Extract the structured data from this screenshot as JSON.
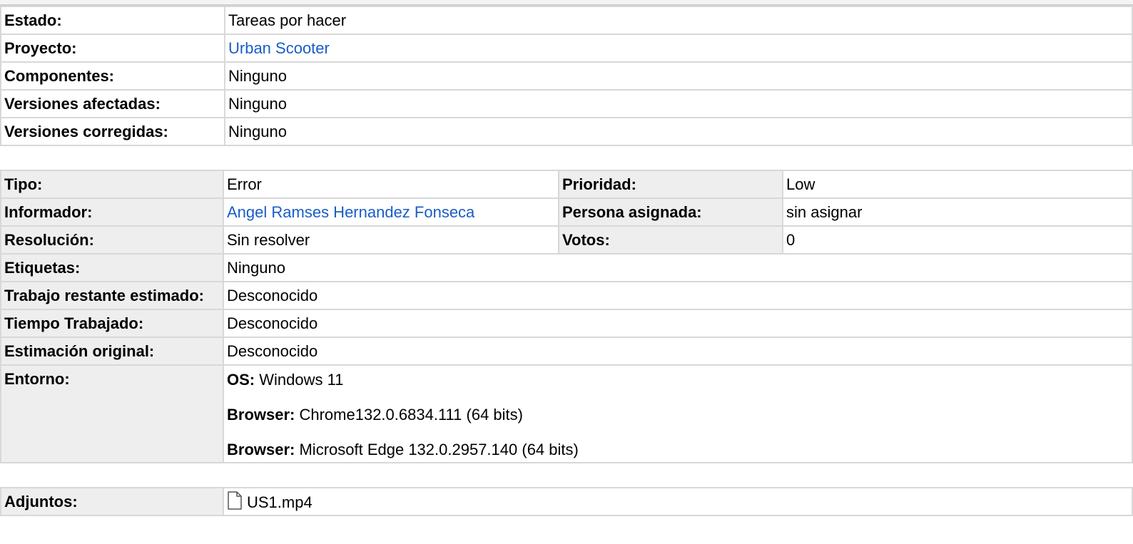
{
  "section1": [
    {
      "label": "Estado:",
      "value": "Tareas por hacer"
    },
    {
      "label": "Proyecto:",
      "value": "Urban Scooter"
    },
    {
      "label": "Componentes:",
      "value": "Ninguno"
    },
    {
      "label": "Versiones afectadas:",
      "value": "Ninguno"
    },
    {
      "label": "Versiones corregidas:",
      "value": "Ninguno"
    }
  ],
  "section2": {
    "tipo": {
      "label": "Tipo:",
      "value": "Error"
    },
    "prioridad": {
      "label": "Prioridad:",
      "value": "Low"
    },
    "informador": {
      "label": "Informador:",
      "value": "Angel Ramses Hernandez Fonseca"
    },
    "asignada": {
      "label": "Persona asignada:",
      "value": "sin asignar"
    },
    "resolucion": {
      "label": "Resolución:",
      "value": "Sin resolver"
    },
    "votos": {
      "label": "Votos:",
      "value": "0"
    },
    "etiquetas": {
      "label": "Etiquetas:",
      "value": "Ninguno"
    },
    "trabajo": {
      "label": "Trabajo restante estimado:",
      "value": "Desconocido"
    },
    "tiempo": {
      "label": "Tiempo Trabajado:",
      "value": "Desconocido"
    },
    "estimacion": {
      "label": "Estimación original:",
      "value": "Desconocido"
    },
    "entorno": {
      "label": "Entorno:",
      "lines": [
        {
          "key": "OS:",
          "value": "Windows 11"
        },
        {
          "key": "Browser:",
          "value": "Chrome132.0.6834.111 (64 bits)"
        },
        {
          "key": "Browser:",
          "value": "Microsoft Edge 132.0.2957.140 (64 bits)"
        }
      ]
    }
  },
  "section3": {
    "label": "Adjuntos:",
    "file": "US1.mp4",
    "file_icon": "document-icon"
  },
  "colors": {
    "link": "#1a5dc7",
    "label_bg": "#eeeeee",
    "border": "#d8d8d8"
  }
}
